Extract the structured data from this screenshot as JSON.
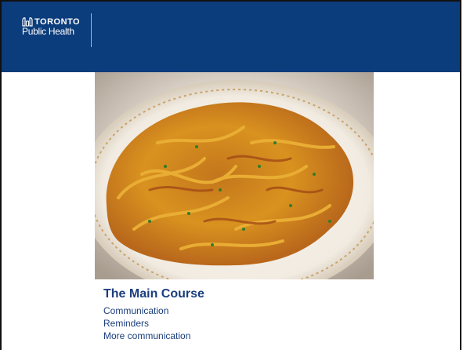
{
  "header": {
    "logo_line1": "Toronto",
    "logo_line2": "Public Health",
    "bg_color": "#0b3c7b"
  },
  "photo": {
    "subject": "plate of tagliatelle pasta with sauce and herbs"
  },
  "caption": {
    "title": "The Main Course",
    "items": [
      "Communication",
      "Reminders",
      "More communication"
    ],
    "color": "#1a3d7c"
  }
}
